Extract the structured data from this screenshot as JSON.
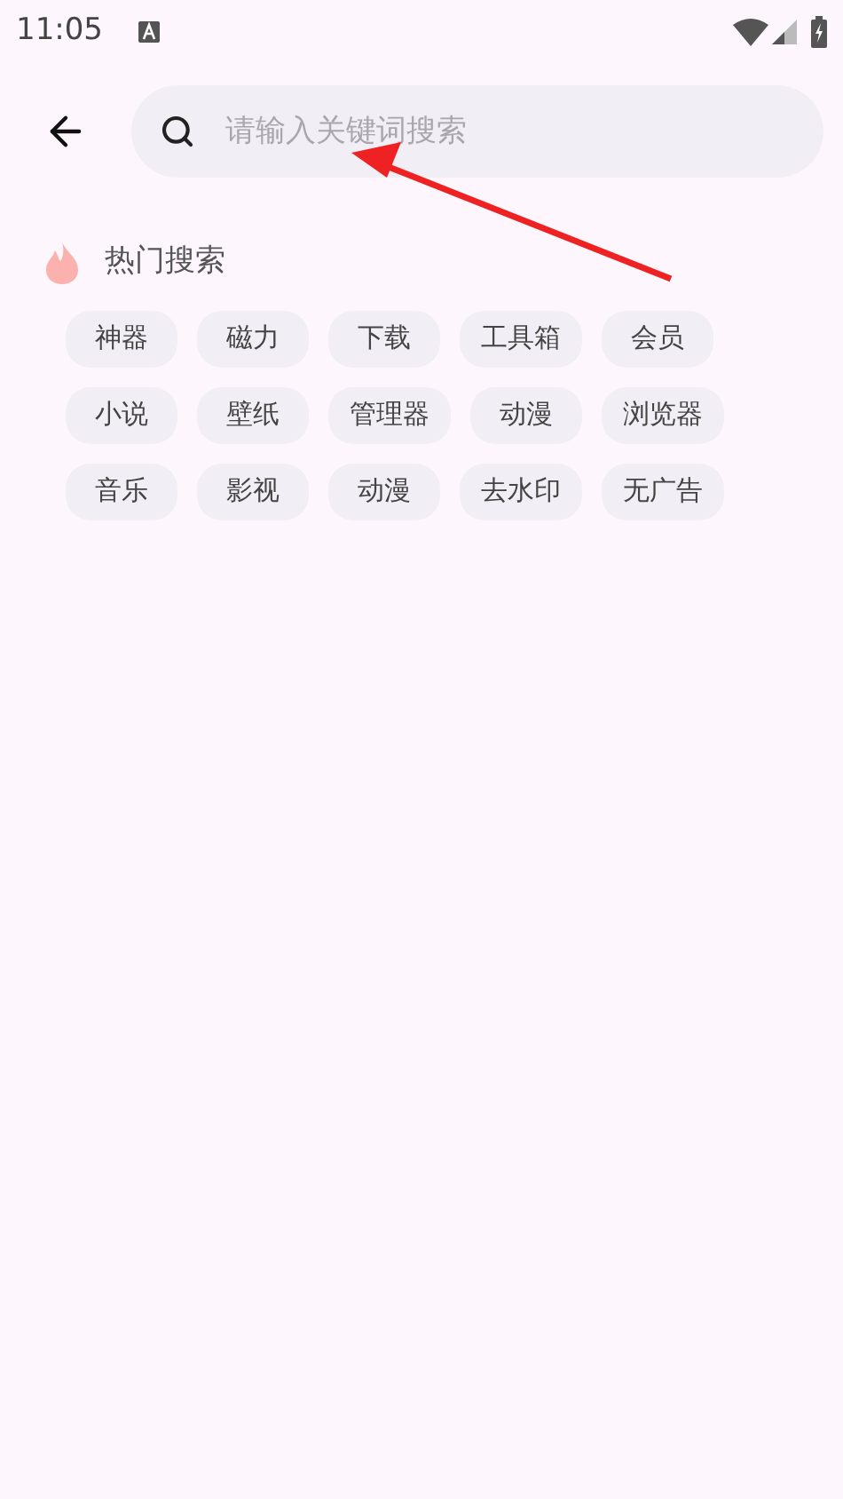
{
  "status_bar": {
    "time": "11:05"
  },
  "search": {
    "placeholder": "请输入关键词搜索"
  },
  "hot": {
    "title": "热门搜索",
    "rows": [
      [
        "神器",
        "磁力",
        "下载",
        "工具箱",
        "会员"
      ],
      [
        "小说",
        "壁纸",
        "管理器",
        "动漫",
        "浏览器"
      ],
      [
        "音乐",
        "影视",
        "动漫",
        "去水印",
        "无广告"
      ]
    ]
  }
}
